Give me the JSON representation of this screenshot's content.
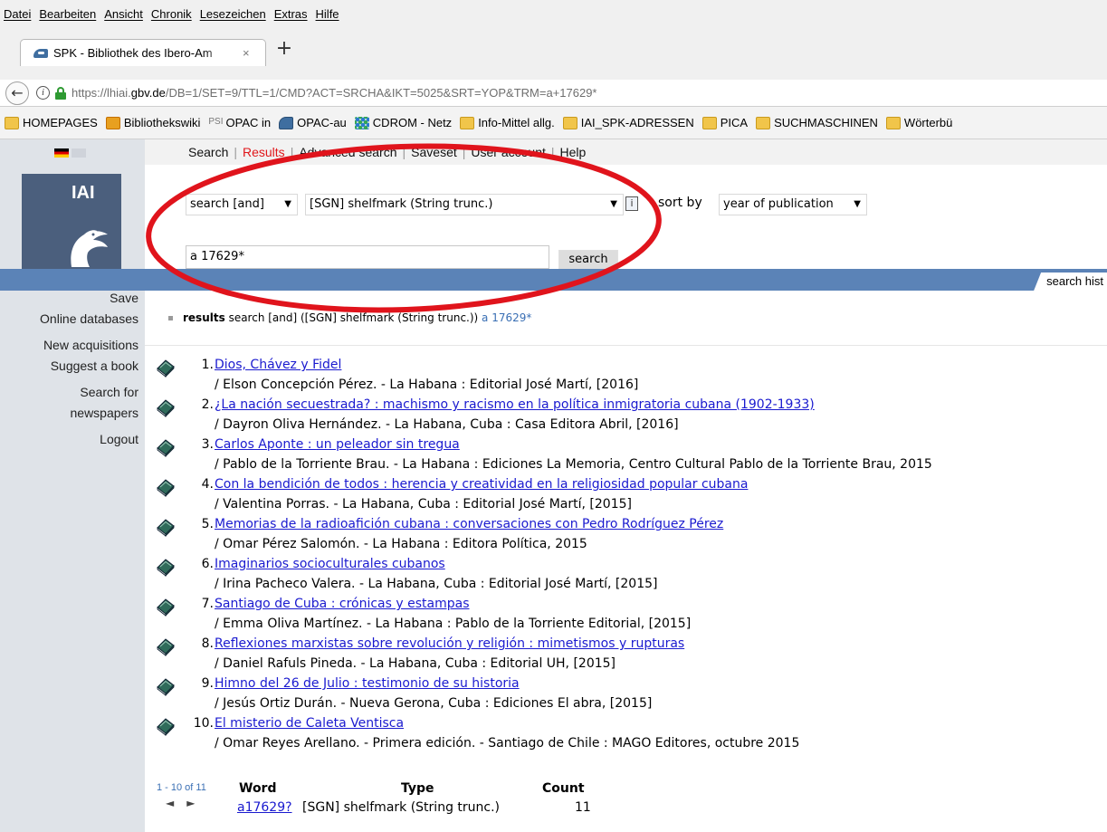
{
  "browser": {
    "menu": [
      "Datei",
      "Bearbeiten",
      "Ansicht",
      "Chronik",
      "Lesezeichen",
      "Extras",
      "Hilfe"
    ],
    "tab_title": "SPK - Bibliothek des Ibero-Am",
    "tab_close": "×",
    "new_tab": "+",
    "url_prefix": "https://lhiai.",
    "url_domain": "gbv.de",
    "url_path": "/DB=1/SET=9/TTL=1/CMD?ACT=SRCHA&IKT=5025&SRT=YOP&TRM=a+17629*",
    "bookmarks": [
      {
        "label": "HOMEPAGES",
        "icon": "folder-icon"
      },
      {
        "label": "Bibliothekswiki",
        "icon": "wiki-icon"
      },
      {
        "label": "OPAC in",
        "icon": "psi-icon",
        "prefix": "PSI"
      },
      {
        "label": "OPAC-au",
        "icon": "opac-icon"
      },
      {
        "label": "CDROM - Netz",
        "icon": "cdrom-icon"
      },
      {
        "label": "Info-Mittel allg.",
        "icon": "folder-icon"
      },
      {
        "label": "IAI_SPK-ADRESSEN",
        "icon": "folder-icon"
      },
      {
        "label": "PICA",
        "icon": "folder-icon"
      },
      {
        "label": "SUCHMASCHINEN",
        "icon": "folder-icon"
      },
      {
        "label": "Wörterbü",
        "icon": "folder-icon"
      }
    ]
  },
  "logo": {
    "text": "IAI"
  },
  "topnav": [
    "Search",
    "Results",
    "Advanced search",
    "Saveset",
    "User account",
    "Help"
  ],
  "search": {
    "operator": "search [and]",
    "index": "[SGN] shelfmark (String trunc.)",
    "info_label": "i",
    "sort_label": "sort by",
    "sort_value": "year of publication",
    "term": "a 17629*",
    "button": "search",
    "history_tab": "search hist"
  },
  "sidebar": [
    "Save",
    "Online databases",
    "New acquisitions",
    "Suggest a book",
    "Search for",
    "newspapers",
    "Logout"
  ],
  "results_summary": {
    "lead": "results",
    "query": "search [and] ([SGN] shelfmark (String trunc.))",
    "term": "a 17629*"
  },
  "hits": [
    {
      "num": "1.",
      "title": "Dios, Chávez y Fidel",
      "desc": "/ Elson Concepción Pérez. - La Habana : Editorial José Martí, [2016]"
    },
    {
      "num": "2.",
      "title": "¿La nación secuestrada? : machismo y racismo en la política inmigratoria cubana (1902-1933)",
      "desc": "/ Dayron Oliva Hernández. - La Habana, Cuba : Casa Editora Abril, [2016]"
    },
    {
      "num": "3.",
      "title": "Carlos Aponte : un peleador sin tregua",
      "desc": "/ Pablo de la Torriente Brau. - La Habana : Ediciones La Memoria, Centro Cultural Pablo de la Torriente Brau, 2015"
    },
    {
      "num": "4.",
      "title": "Con la bendición de todos : herencia y creatividad en la religiosidad popular cubana",
      "desc": "/ Valentina Porras. - La Habana, Cuba : Editorial José Martí, [2015]"
    },
    {
      "num": "5.",
      "title": "Memorias de la radioafición cubana : conversaciones con Pedro Rodríguez Pérez",
      "desc": "/ Omar Pérez Salomón. - La Habana : Editora Política, 2015"
    },
    {
      "num": "6.",
      "title": "Imaginarios socioculturales cubanos",
      "desc": "/ Irina Pacheco Valera. - La Habana, Cuba : Editorial José Martí, [2015]"
    },
    {
      "num": "7.",
      "title": "Santiago de Cuba : crónicas y estampas",
      "desc": "/ Emma Oliva Martínez. - La Habana : Pablo de la Torriente Editorial, [2015]"
    },
    {
      "num": "8.",
      "title": "Reflexiones marxistas sobre revolución y religión : mimetismos y rupturas",
      "desc": "/ Daniel Rafuls Pineda. - La Habana, Cuba : Editorial UH, [2015]"
    },
    {
      "num": "9.",
      "title": "Himno del 26 de Julio : testimonio de su historia",
      "desc": "/ Jesús Ortiz Durán. - Nueva Gerona, Cuba : Ediciones El abra, [2015]"
    },
    {
      "num": "10.",
      "title": "El misterio de Caleta Ventisca",
      "desc": "/ Omar Reyes Arellano. - Primera edición. - Santiago de Chile : MAGO Editores, octubre 2015"
    }
  ],
  "pager": {
    "range": "1 - 10 of 11",
    "prev": "◄",
    "next": "►"
  },
  "word_table": {
    "headers": {
      "word": "Word",
      "type": "Type",
      "count": "Count"
    },
    "row": {
      "word": "a17629?",
      "type": "[SGN] shelfmark (String trunc.)",
      "count": "11"
    }
  },
  "colors": {
    "accent_blue": "#5b83b7",
    "logo_bg": "#4b5f7d",
    "active_nav": "#e0171b",
    "link": "#1a1acf",
    "highlight_ellipse": "#e0141c"
  }
}
